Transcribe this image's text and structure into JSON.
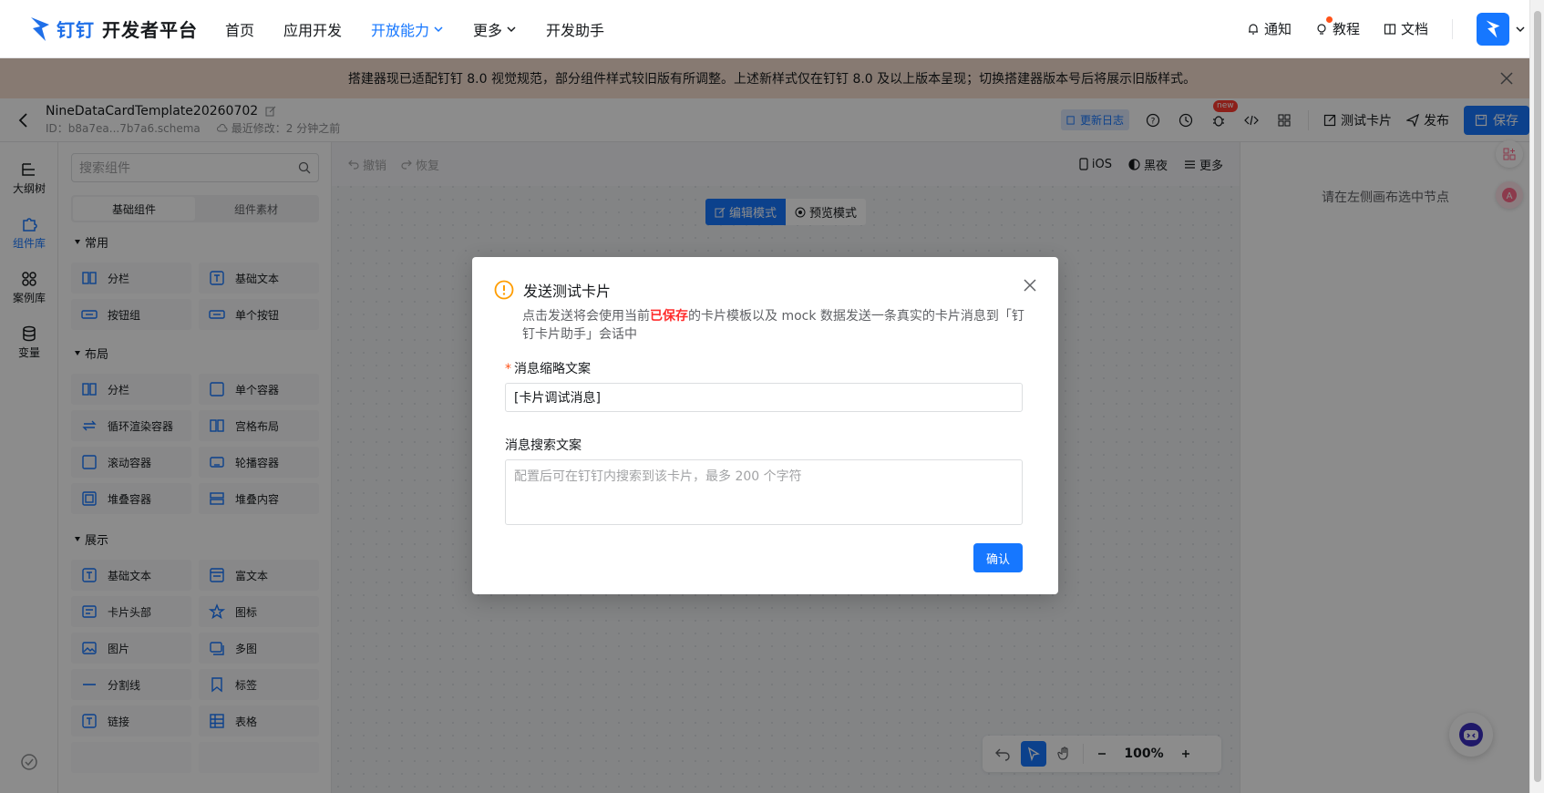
{
  "topnav": {
    "logo_brand": "钉钉",
    "logo_suffix": "开发者平台",
    "menu": [
      {
        "label": "首页"
      },
      {
        "label": "应用开发"
      },
      {
        "label": "开放能力"
      },
      {
        "label": "更多"
      },
      {
        "label": "开发助手"
      }
    ],
    "notify": "通知",
    "tutorial": "教程",
    "docs": "文档"
  },
  "notice": {
    "text": "搭建器现已适配钉钉 8.0 视觉规范，部分组件样式较旧版有所调整。上述新样式仅在钉钉 8.0 及以上版本呈现；切换搭建器版本号后将展示旧版样式。"
  },
  "editor": {
    "template_name": "NineDataCardTemplate20260702",
    "id_text": "ID：b8a7ea...7b7a6.schema",
    "modified_text": "最近修改：2 分钟之前",
    "changelog": "更新日志",
    "new_badge": "new",
    "test_card": "测试卡片",
    "publish": "发布",
    "save": "保存"
  },
  "rail": [
    {
      "label": "大纲树"
    },
    {
      "label": "组件库"
    },
    {
      "label": "案例库"
    },
    {
      "label": "变量"
    }
  ],
  "panel": {
    "search_placeholder": "搜索组件",
    "tabs": [
      "基础组件",
      "组件素材"
    ],
    "sections": [
      {
        "title": "常用",
        "items": [
          "分栏",
          "基础文本",
          "按钮组",
          "单个按钮"
        ]
      },
      {
        "title": "布局",
        "items": [
          "分栏",
          "单个容器",
          "循环渲染容器",
          "宫格布局",
          "滚动容器",
          "轮播容器",
          "堆叠容器",
          "堆叠内容"
        ]
      },
      {
        "title": "展示",
        "items": [
          "基础文本",
          "富文本",
          "卡片头部",
          "图标",
          "图片",
          "多图",
          "分割线",
          "标签",
          "链接",
          "表格"
        ]
      }
    ]
  },
  "canvas": {
    "undo": "撤销",
    "redo": "恢复",
    "device": "iOS",
    "theme": "黑夜",
    "more": "更多",
    "edit_mode": "编辑模式",
    "preview_mode": "预览模式",
    "zoom": "100%"
  },
  "rpanel": {
    "hint": "请在左侧画布选中节点"
  },
  "modal": {
    "title": "发送测试卡片",
    "desc_before": "点击发送将会使用当前",
    "desc_bold": "已保存",
    "desc_after": "的卡片模板以及 mock 数据发送一条真实的卡片消息到「钉钉卡片助手」会话中",
    "summary_label": "消息缩略文案",
    "summary_value": "[卡片调试消息]",
    "search_label": "消息搜索文案",
    "search_placeholder": "配置后可在钉钉内搜索到该卡片，最多 200 个字符",
    "confirm": "确认"
  },
  "colors": {
    "primary": "#1677ff",
    "warning": "#ff9d00",
    "notice_bg": "#f6dfcf",
    "danger": "#ff2d2d"
  }
}
